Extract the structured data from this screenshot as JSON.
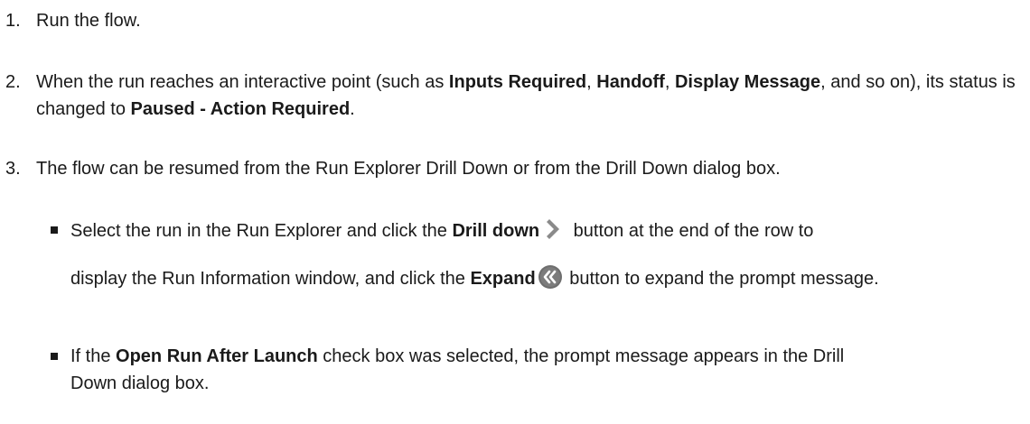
{
  "steps": [
    {
      "num": "1.",
      "text": "Run the flow."
    },
    {
      "num": "2.",
      "t1": "When the run reaches an interactive point (such as ",
      "b1": "Inputs Required",
      "t2": ", ",
      "b2": "Handoff",
      "t3": ", ",
      "b3": "Display Message",
      "t4": ", and so on), its status is changed to ",
      "b4": "Paused - Action Required",
      "t5": "."
    },
    {
      "num": "3.",
      "text": "The flow can be resumed from the Run Explorer Drill Down or from the Drill Down dialog box."
    }
  ],
  "bullets": [
    {
      "t1": "Select the run in the Run Explorer and click the ",
      "b1": "Drill down",
      "icon1": "chevron-right-icon",
      "t2": " button at the end of the row to",
      "t3": "display the Run Information window, and click the ",
      "b2": "Expand",
      "icon2": "double-chevron-left-icon",
      "t4": " button to expand the prompt message."
    },
    {
      "t1": "If the ",
      "b1": "Open Run After Launch",
      "t2": " check box was selected, the prompt message appears in the Drill Down dialog box."
    }
  ],
  "colors": {
    "text": "#1a1a1a",
    "chevron": "#8a8a8a",
    "expand_bg": "#6e6e6e"
  }
}
